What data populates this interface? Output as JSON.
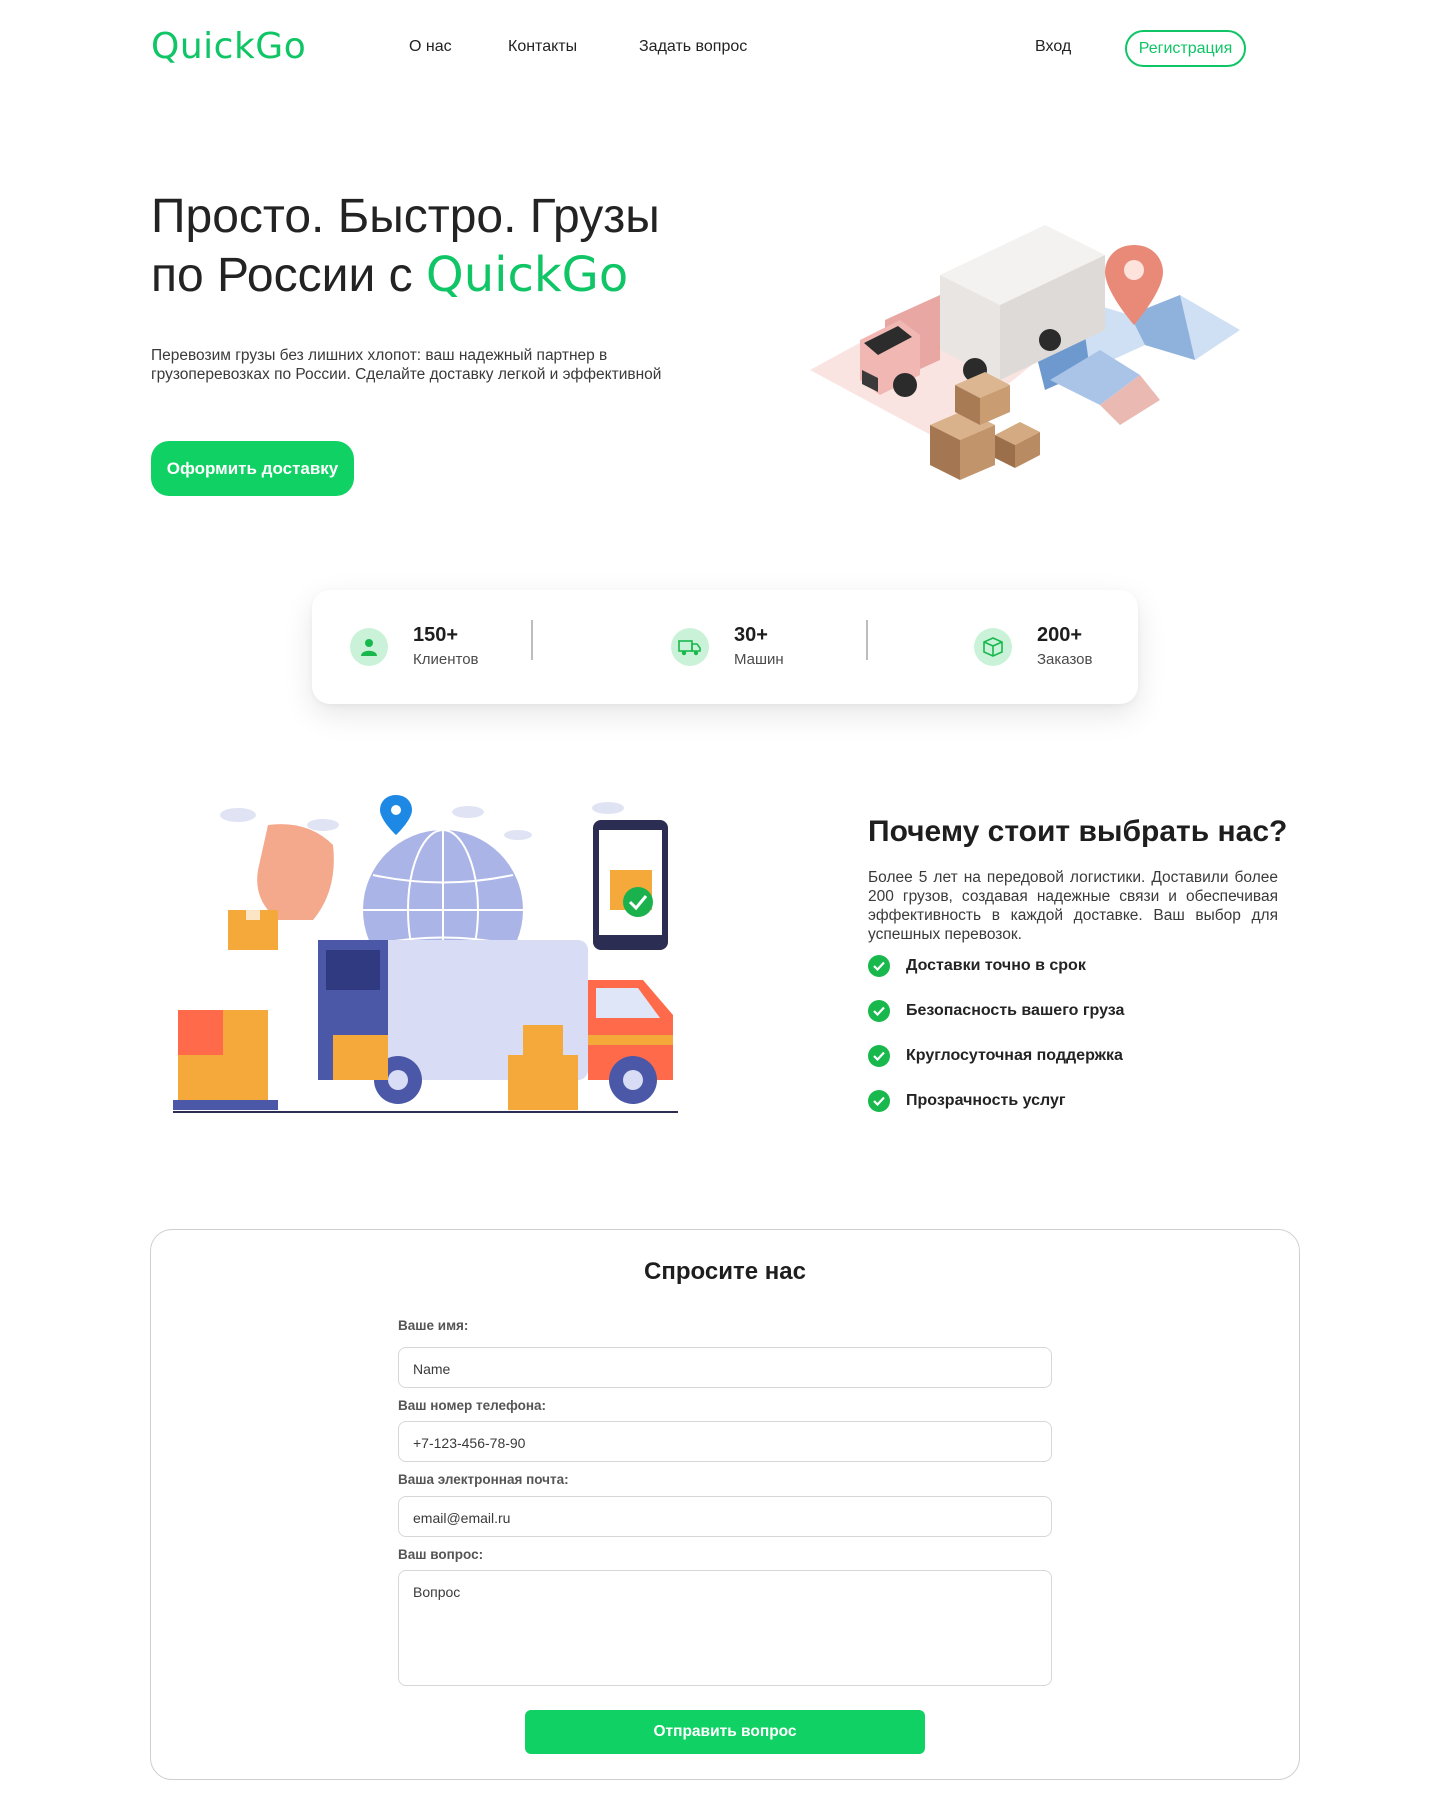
{
  "header": {
    "logo": "QuickGo",
    "nav": [
      "О нас",
      "Контакты",
      "Задать вопрос"
    ],
    "login": "Вход",
    "register": "Регистрация"
  },
  "hero": {
    "title_line1": "Просто. Быстро. Грузы",
    "title_line2_prefix": "по России с ",
    "title_brand": "QuickGo",
    "subtitle": "Перевозим грузы без лишних хлопот: ваш надежный партнер в грузоперевозках по России. Сделайте доставку легкой и эффективной",
    "cta": "Оформить доставку",
    "illustration_icon": "delivery-truck-map-boxes"
  },
  "stats": [
    {
      "value": "150+",
      "label": "Клиентов",
      "icon": "user-icon"
    },
    {
      "value": "30+",
      "label": "Машин",
      "icon": "truck-icon"
    },
    {
      "value": "200+",
      "label": "Заказов",
      "icon": "box-icon"
    }
  ],
  "why": {
    "title": "Почему стоит выбрать нас?",
    "text": "Более 5 лет на передовой логистики. Доставили более 200 грузов, создавая надежные связи и обеспечивая эффективность в каждой доставке. Ваш выбор для успешных перевозок.",
    "features": [
      "Доставки точно в срок",
      "Безопасность вашего груза",
      "Круглосуточная поддержка",
      "Прозрачность услуг"
    ]
  },
  "form": {
    "title": "Спросите нас",
    "name_label": "Ваше имя:",
    "name_placeholder": "Name",
    "phone_label": "Ваш номер телефона:",
    "phone_placeholder": "+7-123-456-78-90",
    "email_label": "Ваша электронная почта:",
    "email_placeholder": "email@email.ru",
    "question_label": "Ваш вопрос:",
    "question_placeholder": "Вопрос",
    "submit": "Отправить вопрос"
  },
  "colors": {
    "brand_green": "#10c566",
    "button_green": "#10d163",
    "check_green": "#18b84d",
    "icon_bg": "#c9f2d8"
  }
}
